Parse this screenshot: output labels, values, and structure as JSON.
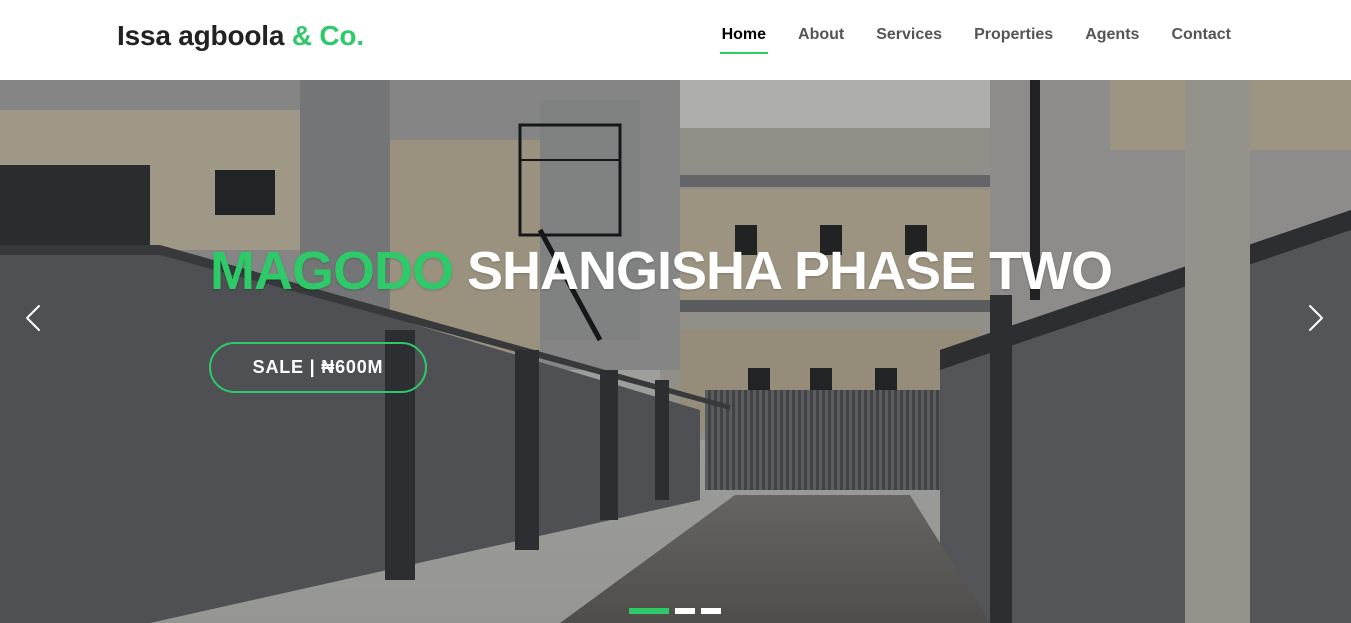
{
  "brand": {
    "name": "Issa agboola",
    "accent": "& Co."
  },
  "nav": {
    "items": [
      {
        "label": "Home",
        "active": true
      },
      {
        "label": "About"
      },
      {
        "label": "Services"
      },
      {
        "label": "Properties"
      },
      {
        "label": "Agents"
      },
      {
        "label": "Contact"
      }
    ]
  },
  "hero": {
    "title_accent": "MAGODO",
    "title_rest": "SHANGISHA PHASE TWO",
    "cta_label": "SALE | ₦600M",
    "prev_icon": "chevron-left-icon",
    "next_icon": "chevron-right-icon",
    "slides_count": 3,
    "active_slide": 1
  },
  "colors": {
    "accent": "#2eca6a",
    "text_dark": "#222222",
    "nav_text": "#555555",
    "white": "#ffffff"
  }
}
